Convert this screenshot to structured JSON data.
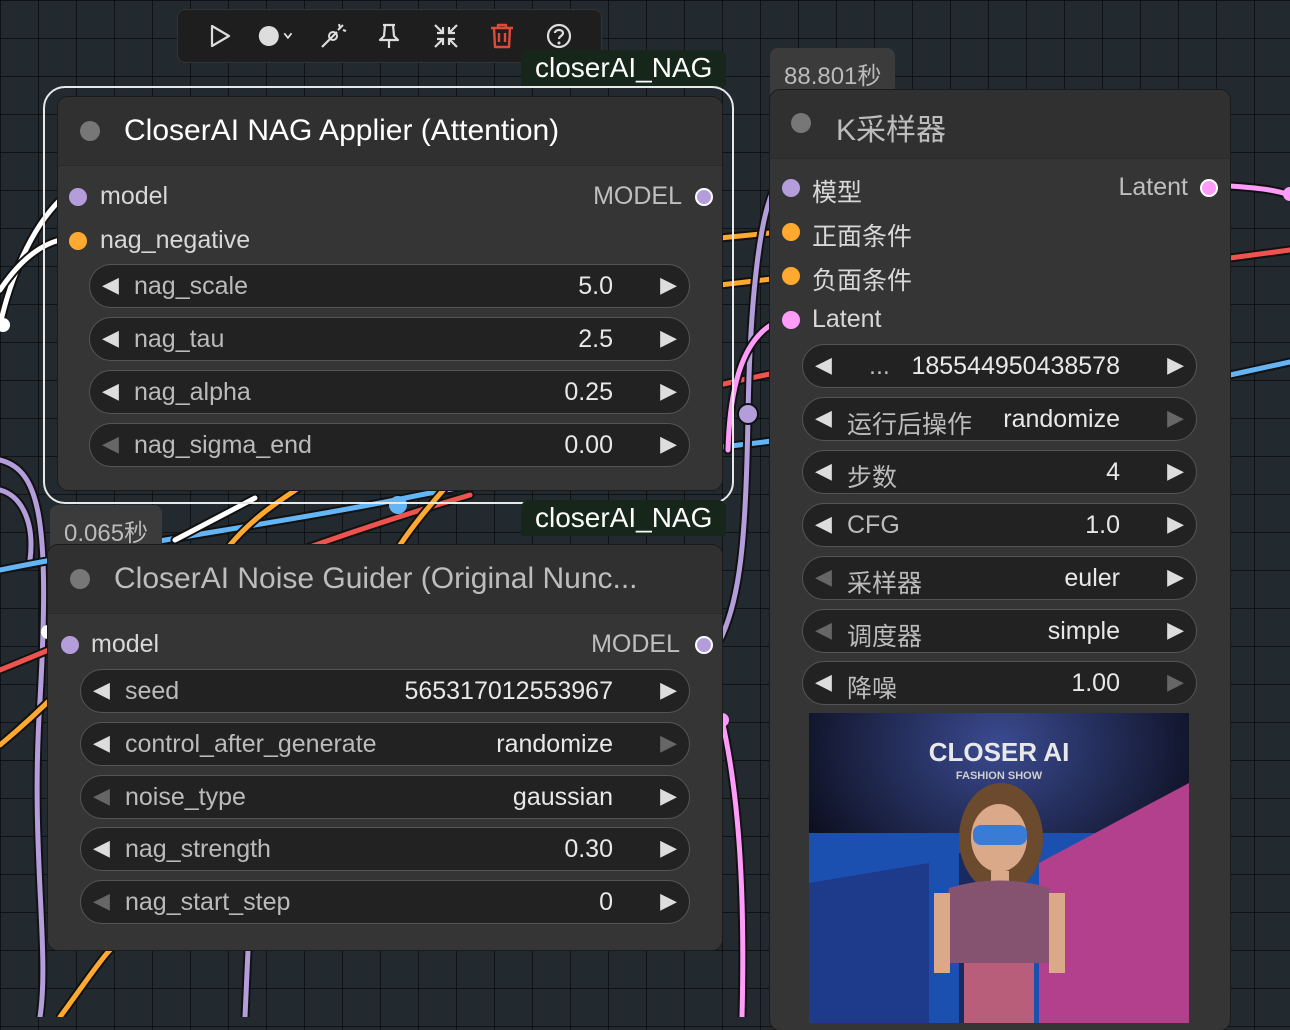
{
  "toolbar": {
    "buttons": [
      {
        "name": "run-button",
        "icon": "play-icon"
      },
      {
        "name": "color-button",
        "icon": "circle-dropdown-icon"
      },
      {
        "name": "bypass-button",
        "icon": "wand-icon"
      },
      {
        "name": "pin-button",
        "icon": "pin-icon"
      },
      {
        "name": "collapse-button",
        "icon": "collapse-icon"
      },
      {
        "name": "delete-button",
        "icon": "trash-icon"
      },
      {
        "name": "help-button",
        "icon": "help-icon"
      }
    ],
    "delete_color": "#e04a3a"
  },
  "nag_applier": {
    "badge": "closerAI_NAG",
    "title": "CloserAI NAG Applier (Attention)",
    "inputs": [
      {
        "label": "model",
        "color": "#b39ddb"
      },
      {
        "label": "nag_negative",
        "color": "#ffa931"
      }
    ],
    "output": {
      "label": "MODEL",
      "color": "#b39ddb"
    },
    "widgets": [
      {
        "name": "nag_scale",
        "value": "5.0"
      },
      {
        "name": "nag_tau",
        "value": "2.5"
      },
      {
        "name": "nag_alpha",
        "value": "0.25"
      },
      {
        "name": "nag_sigma_end",
        "value": "0.00"
      }
    ]
  },
  "noise_guider": {
    "time": "0.065秒",
    "badge": "closerAI_NAG",
    "title": "CloserAI Noise Guider (Original Nunc...",
    "input": {
      "label": "model",
      "color": "#b39ddb"
    },
    "output": {
      "label": "MODEL",
      "color": "#b39ddb"
    },
    "widgets": [
      {
        "name": "seed",
        "value": "565317012553967"
      },
      {
        "name": "control_after_generate",
        "value": "randomize"
      },
      {
        "name": "noise_type",
        "value": "gaussian"
      },
      {
        "name": "nag_strength",
        "value": "0.30"
      },
      {
        "name": "nag_start_step",
        "value": "0"
      }
    ]
  },
  "ksampler": {
    "time": "88.801秒",
    "title": "K采样器",
    "inputs": [
      {
        "label": "模型",
        "color": "#b39ddb"
      },
      {
        "label": "正面条件",
        "color": "#ffa931"
      },
      {
        "label": "负面条件",
        "color": "#ffa931"
      },
      {
        "label": "Latent",
        "color": "#ff9cf9"
      }
    ],
    "output": {
      "label": "Latent",
      "color": "#ff9cf9"
    },
    "widgets": [
      {
        "name": "...",
        "value": "185544950438578"
      },
      {
        "name": "运行后操作",
        "value": "randomize"
      },
      {
        "name": "步数",
        "value": "4"
      },
      {
        "name": "CFG",
        "value": "1.0"
      },
      {
        "name": "采样器",
        "value": "euler"
      },
      {
        "name": "调度器",
        "value": "simple"
      },
      {
        "name": "降噪",
        "value": "1.00"
      }
    ],
    "preview": {
      "brand": "CLOSER AI",
      "subtitle": "FASHION SHOW"
    }
  }
}
